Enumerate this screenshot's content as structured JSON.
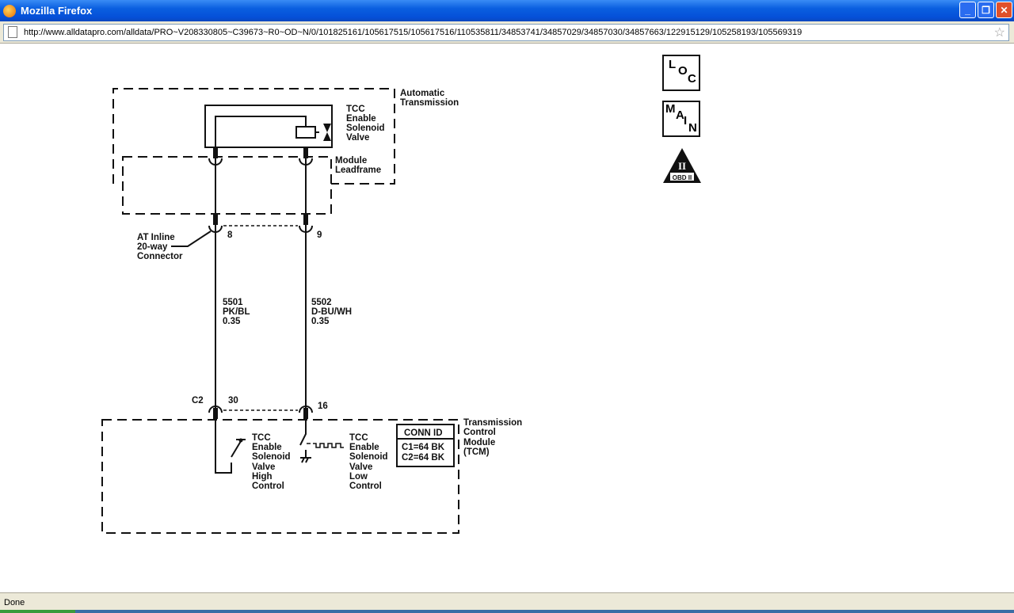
{
  "window": {
    "title": "Mozilla Firefox"
  },
  "address_bar": {
    "url": "http://www.alldatapro.com/alldata/PRO~V208330805~C39673~R0~OD~N/0/101825161/105617515/105617516/110535811/34853741/34857029/34857030/34857663/122915129/105258193/105569319"
  },
  "status_bar": {
    "text": "Done"
  },
  "icons": {
    "loc": [
      "L",
      "O",
      "C"
    ],
    "main": [
      "M",
      "A",
      "I",
      "N"
    ],
    "obd": {
      "numeral": "II",
      "label": "OBD II"
    }
  },
  "diagram": {
    "automatic_transmission": [
      "Automatic",
      "Transmission"
    ],
    "solenoid": [
      "TCC",
      "Enable",
      "Solenoid",
      "Valve"
    ],
    "leadframe": [
      "Module",
      "Leadframe"
    ],
    "inline_connector": [
      "AT Inline",
      "20-way",
      "Connector"
    ],
    "pins_inline": [
      "8",
      "9"
    ],
    "wire1": [
      "5501",
      "PK/BL",
      "0.35"
    ],
    "wire2": [
      "5502",
      "D-BU/WH",
      "0.35"
    ],
    "connector_c2": "C2",
    "pins_tcm": [
      "30",
      "16"
    ],
    "high_control": [
      "TCC",
      "Enable",
      "Solenoid",
      "Valve",
      "High",
      "Control"
    ],
    "low_control": [
      "TCC",
      "Enable",
      "Solenoid",
      "Valve",
      "Low",
      "Control"
    ],
    "conn_id": {
      "title": "CONN ID",
      "rows": [
        "C1=64 BK",
        "C2=64 BK"
      ]
    },
    "tcm": [
      "Transmission",
      "Control",
      "Module",
      "(TCM)"
    ]
  }
}
